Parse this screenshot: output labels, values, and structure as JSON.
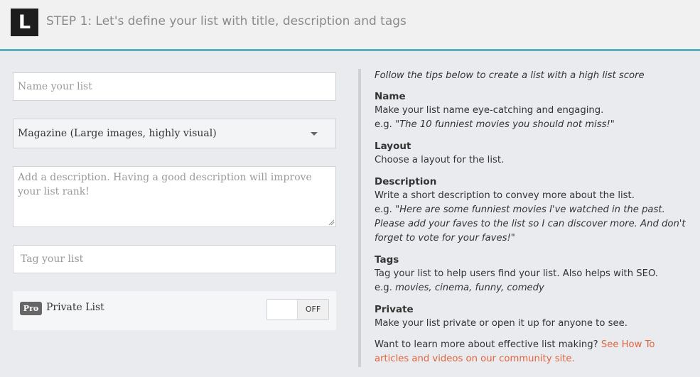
{
  "header": {
    "logo_letter": "L",
    "step_title": "STEP 1: Let's define your list with title, description and tags"
  },
  "form": {
    "name_placeholder": "Name your list",
    "layout_selected": "Magazine (Large images, highly visual)",
    "description_placeholder": "Add a description. Having a good description will improve your list rank!",
    "tag_placeholder": "Tag your list",
    "private": {
      "badge": "Pro",
      "label": "Private List",
      "toggle_state": "OFF"
    }
  },
  "tips": {
    "intro": "Follow the tips below to create a list with a high list score",
    "sections": [
      {
        "title": "Name",
        "text": "Make your list name eye-catching and engaging.",
        "example_prefix": "e.g. ",
        "example": "\"The 10 funniest movies you should not miss!\""
      },
      {
        "title": "Layout",
        "text": "Choose a layout for the list."
      },
      {
        "title": "Description",
        "text": "Write a short description to convey more about the list.",
        "example_prefix": "e.g. ",
        "example": "\"Here are some funniest movies I've watched in the past. Please add your faves to the list so I can discover more. And don't forget to vote for your faves!\""
      },
      {
        "title": "Tags",
        "text": "Tag your list to help users find your list. Also helps with SEO.",
        "example_prefix": "e.g. ",
        "example": "movies, cinema, funny, comedy"
      },
      {
        "title": "Private",
        "text": "Make your list private or open it up for anyone to see."
      }
    ],
    "footer_text": "Want to learn more about effective list making? ",
    "footer_link": "See How To articles and videos on our community site."
  },
  "colors": {
    "accent": "#5ab0bd",
    "link": "#e0643f",
    "background": "#e9ebee"
  }
}
